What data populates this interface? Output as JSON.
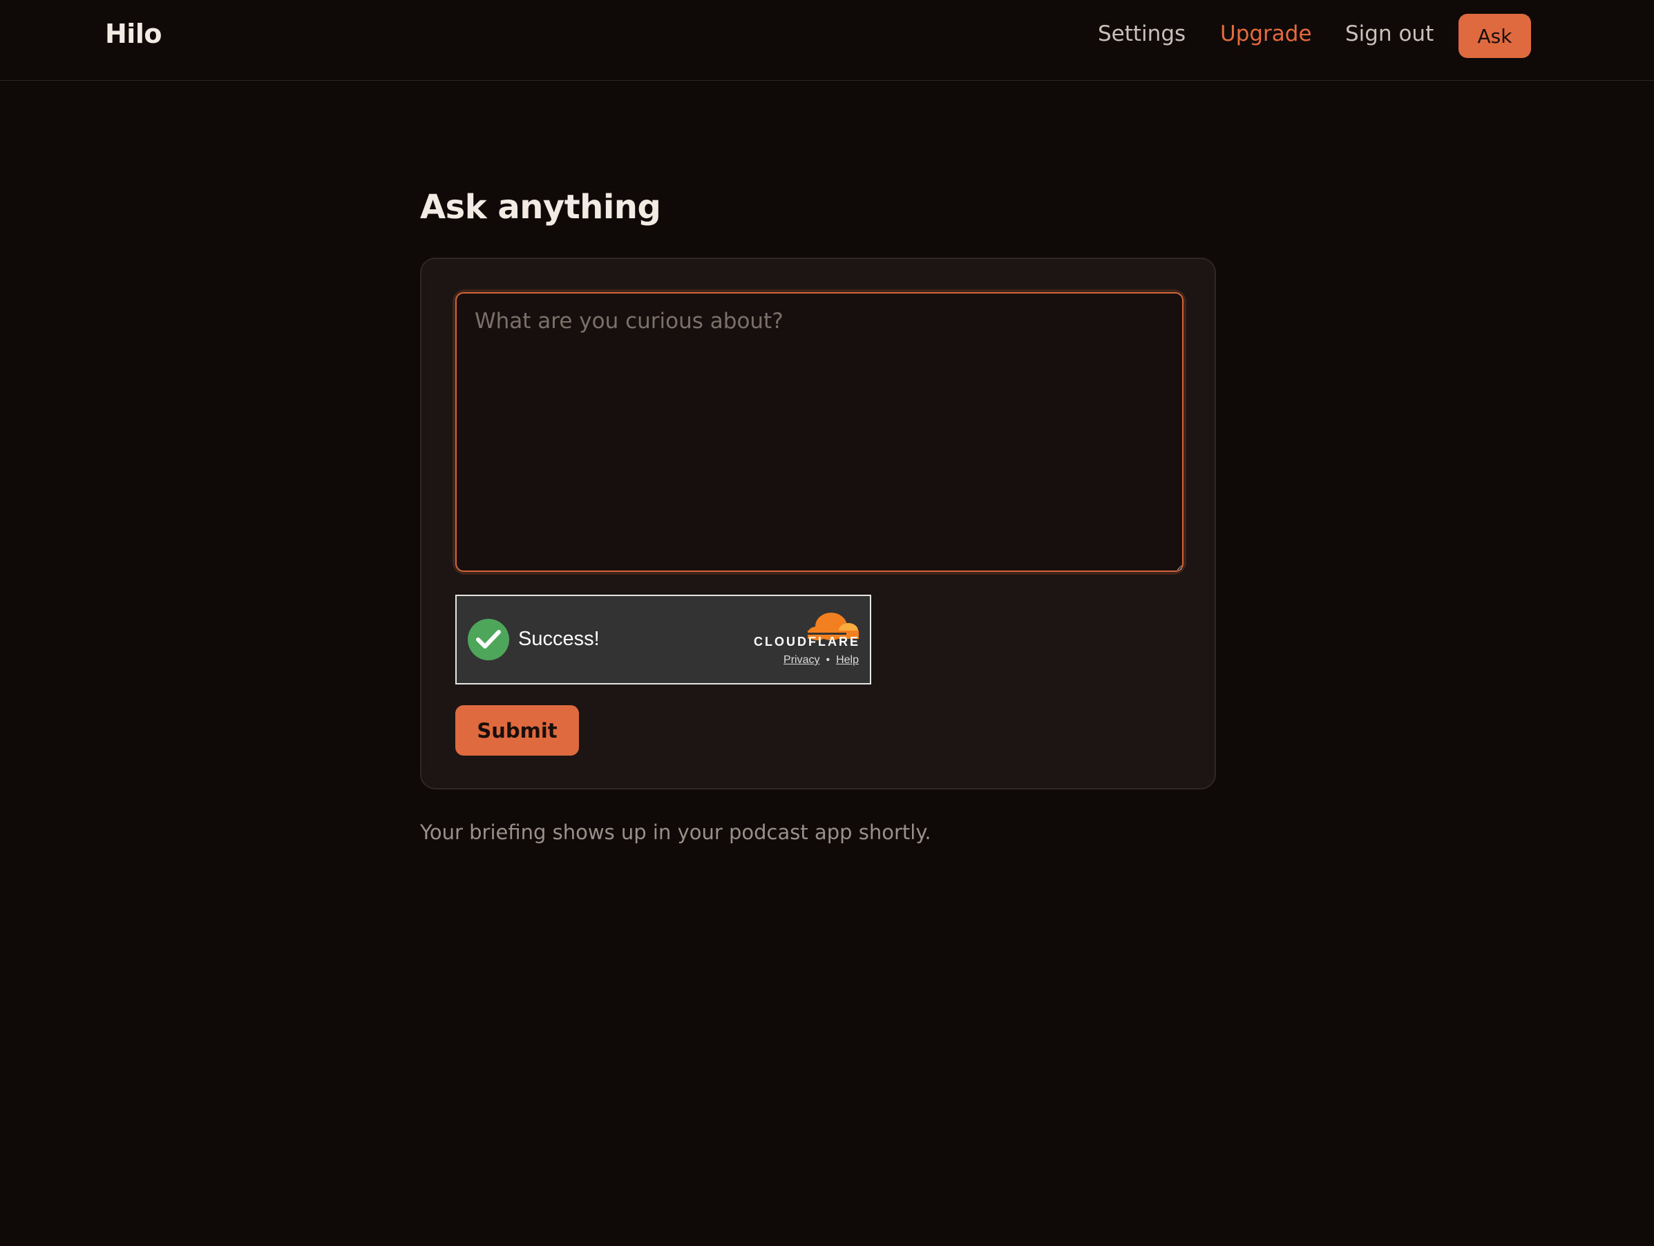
{
  "header": {
    "brand": "Hilo",
    "nav": {
      "settings": "Settings",
      "upgrade": "Upgrade",
      "sign_out": "Sign out",
      "ask": "Ask"
    }
  },
  "main": {
    "title": "Ask anything",
    "question": {
      "value": "",
      "placeholder": "What are you curious about?"
    },
    "captcha": {
      "status": "Success!",
      "brand": "CLOUDFLARE",
      "privacy": "Privacy",
      "separator": "•",
      "help": "Help",
      "check_icon": "check-circle-icon",
      "logo_icon": "cloudflare-cloud-icon"
    },
    "submit_label": "Submit",
    "note": "Your briefing shows up in your podcast app shortly."
  },
  "colors": {
    "background": "#0f0908",
    "card": "#1c1513",
    "accent": "#e06a3f",
    "success": "#4ea65a",
    "captcha_bg": "#333333"
  }
}
